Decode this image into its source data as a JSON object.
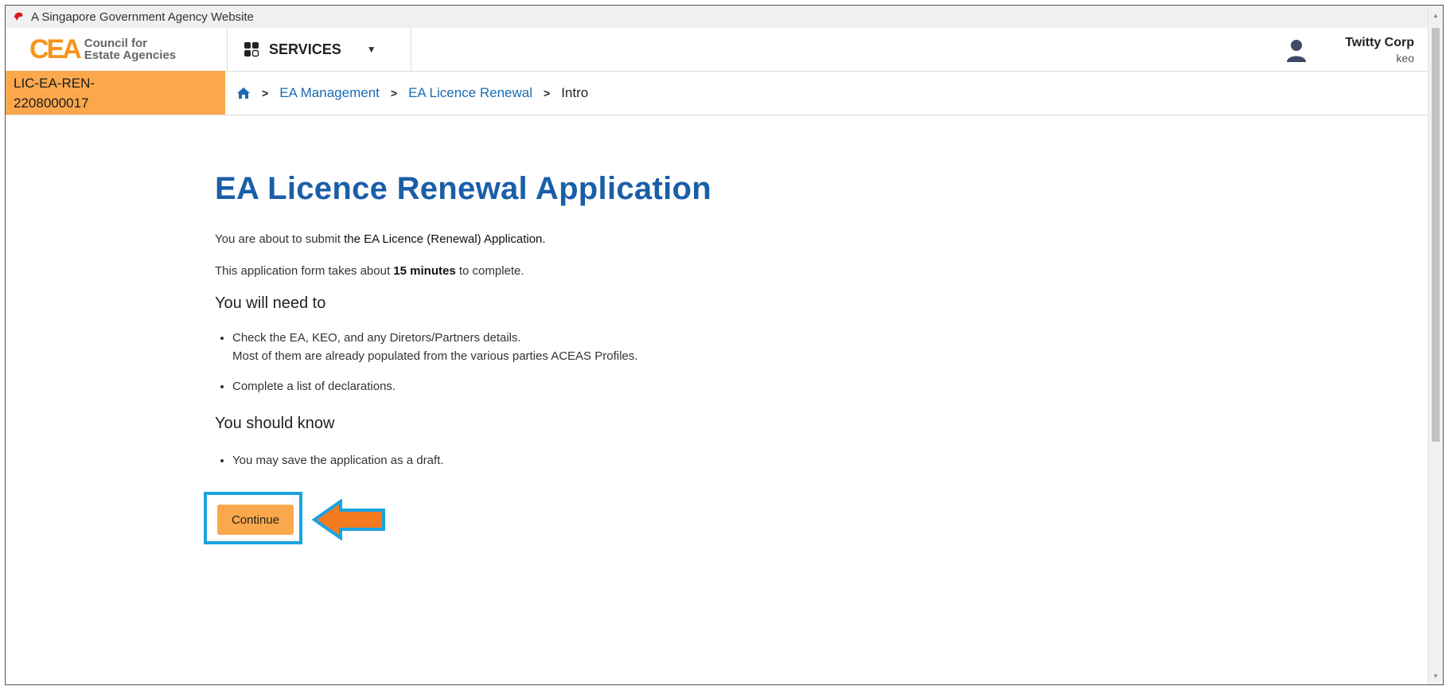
{
  "gov_bar": {
    "text": "A Singapore Government Agency Website"
  },
  "header": {
    "logo_mark": "CEA",
    "logo_line1": "Council for",
    "logo_line2": "Estate Agencies",
    "services_label": "SERVICES",
    "user_company": "Twitty Corp",
    "user_role": "keo"
  },
  "subbar": {
    "licence_line1": "LIC-EA-REN-",
    "licence_line2": "2208000017",
    "breadcrumb": [
      "EA Management",
      "EA Licence Renewal",
      "Intro"
    ]
  },
  "main": {
    "title": "EA Licence Renewal Application",
    "intro_prefix": "You are about to submit ",
    "intro_app": "the EA Licence (Renewal) Application.",
    "duration_prefix": "This application form takes about ",
    "duration_bold": "15 minutes",
    "duration_suffix": " to complete.",
    "need_heading": "You will need to",
    "need_items": [
      {
        "line1": "Check the EA, KEO, and any Diretors/Partners details.",
        "line2": "Most of them are already populated from the various parties ACEAS Profiles."
      },
      {
        "line1": "Complete a list of declarations.",
        "line2": ""
      }
    ],
    "know_heading": "You should know",
    "know_items": [
      "You may save the application as a draft."
    ],
    "continue_label": "Continue"
  },
  "colors": {
    "accent_orange": "#fba84c",
    "title_blue": "#1a5ea8",
    "link_blue": "#1a6bb3",
    "highlight_blue": "#1aa3e0",
    "arrow_orange": "#f47b20"
  }
}
